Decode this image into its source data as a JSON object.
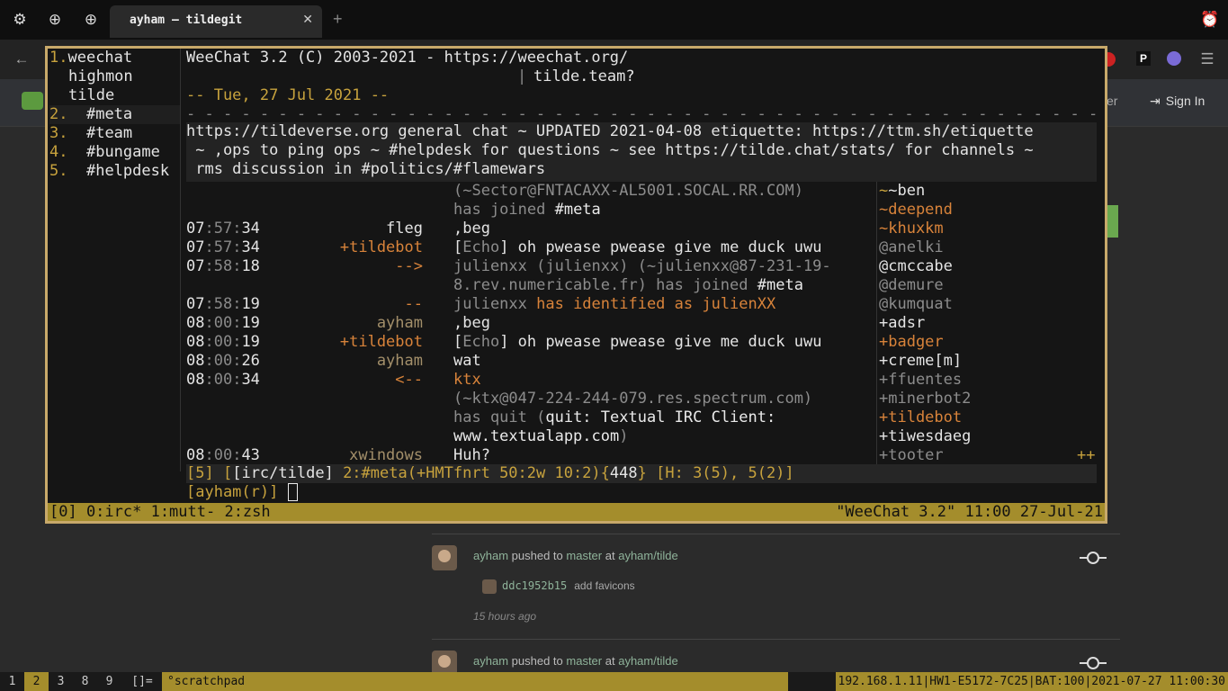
{
  "browser": {
    "tab_title": "ayham — tildegit",
    "close_glyph": "✕",
    "new_tab_glyph": "+",
    "back_glyph": "←",
    "ext_p": "P"
  },
  "site": {
    "partial_label": "er",
    "sign_in": "Sign In"
  },
  "feed": [
    {
      "user": "ayham",
      "action": "pushed to",
      "branch": "master",
      "at": "at",
      "repo": "ayham/tilde",
      "sha": "ddc1952b15",
      "message": "add favicons",
      "time": "15 hours ago"
    },
    {
      "user": "ayham",
      "action": "pushed to",
      "branch": "master",
      "at": "at",
      "repo": "ayham/tilde"
    }
  ],
  "weechat": {
    "buffers": [
      {
        "num": "1.",
        "name": "weechat"
      },
      {
        "num": "",
        "name": "highmon"
      },
      {
        "num": "",
        "name": "tilde"
      },
      {
        "num": "2.",
        "name": "#meta"
      },
      {
        "num": "3.",
        "name": "#team"
      },
      {
        "num": "4.",
        "name": "#bungame"
      },
      {
        "num": "5.",
        "name": "#helpdesk"
      }
    ],
    "header_line1": "WeeChat 3.2 (C) 2003-2021 - https://weechat.org/",
    "header_line2": "tilde.team?",
    "date_line": "-- Tue, 27 Jul 2021 --",
    "topic": [
      "https://tildeverse.org general chat ~ UPDATED 2021-04-08 etiquette: https://ttm.sh/etiquette",
      " ~ ,ops to ping ops ~ #helpdesk for questions ~ see https://tilde.chat/stats/ for channels ~",
      " rms discussion in #politics/#flamewars"
    ],
    "messages": [
      {
        "hh": "",
        "mm": "",
        "nick": "",
        "text": "(~Sector@FNTACAXX-AL5001.SOCAL.RR.COM)"
      },
      {
        "hh": "",
        "mm": "",
        "nick": "",
        "text": "has joined #meta"
      },
      {
        "hh": "07",
        "mm": ":57:",
        "ss": "34",
        "nick": "fleg",
        "text": ",beg"
      },
      {
        "hh": "07",
        "mm": ":57:",
        "ss": "34",
        "nick": "+tildebot",
        "text": "[Echo] oh pwease pwease give me duck uwu"
      },
      {
        "hh": "07",
        "mm": ":58:",
        "ss": "18",
        "nick": "-->",
        "text": "julienxx (julienxx) (~julienxx@87-231-19-"
      },
      {
        "hh": "",
        "mm": "",
        "nick": "",
        "text": "8.rev.numericable.fr) has joined #meta"
      },
      {
        "hh": "07",
        "mm": ":58:",
        "ss": "19",
        "nick": "--",
        "text": "julienxx has identified as julienXX"
      },
      {
        "hh": "08",
        "mm": ":00:",
        "ss": "19",
        "nick": "ayham",
        "text": ",beg"
      },
      {
        "hh": "08",
        "mm": ":00:",
        "ss": "19",
        "nick": "+tildebot",
        "text": "[Echo] oh pwease pwease give me duck uwu"
      },
      {
        "hh": "08",
        "mm": ":00:",
        "ss": "26",
        "nick": "ayham",
        "text": "wat"
      },
      {
        "hh": "08",
        "mm": ":00:",
        "ss": "34",
        "nick": "<--",
        "text": "ktx"
      },
      {
        "hh": "",
        "mm": "",
        "nick": "",
        "text": "(~ktx@047-224-244-079.res.spectrum.com)"
      },
      {
        "hh": "",
        "mm": "",
        "nick": "",
        "text": "has quit (quit: Textual IRC Client:"
      },
      {
        "hh": "",
        "mm": "",
        "nick": "",
        "text": "www.textualapp.com)"
      },
      {
        "hh": "08",
        "mm": ":00:",
        "ss": "43",
        "nick": "xwindows",
        "text": "Huh?"
      }
    ],
    "nicklist": [
      "~ben",
      "~deepend",
      "~khuxkm",
      "@anelki",
      "@cmccabe",
      "@demure",
      "@kumquat",
      "+adsr",
      "+badger",
      "+creme[m]",
      "+ffuentes",
      "+minerbot2",
      "+tildebot",
      "+tiwesdaeg",
      "+tooter"
    ],
    "nicklist_more": "++",
    "status": {
      "buf_num": "[5]",
      "server": "[irc/tilde]",
      "channel": "2:#meta",
      "modes": "(+HMTfnrt 50:2w 10:2)",
      "count_open": "{",
      "count": "448",
      "count_close": "}",
      "hotlist": "[H: 3(5), 5(2)]"
    },
    "input_prompt": "[ayham(r)]"
  },
  "tmux": {
    "windows": "[0] 0:irc* 1:mutt- 2:zsh",
    "right": "\"WeeChat 3.2\" 11:00 27-Jul-21"
  },
  "wm": {
    "workspaces": [
      "1",
      "2",
      "3",
      "8",
      "9"
    ],
    "layout": "[]=",
    "scratch_marker": "°",
    "scratch": "scratchpad",
    "sysinfo": "192.168.1.11|HW1-E5172-7C25|BAT:100|2021-07-27 11:00:30"
  }
}
